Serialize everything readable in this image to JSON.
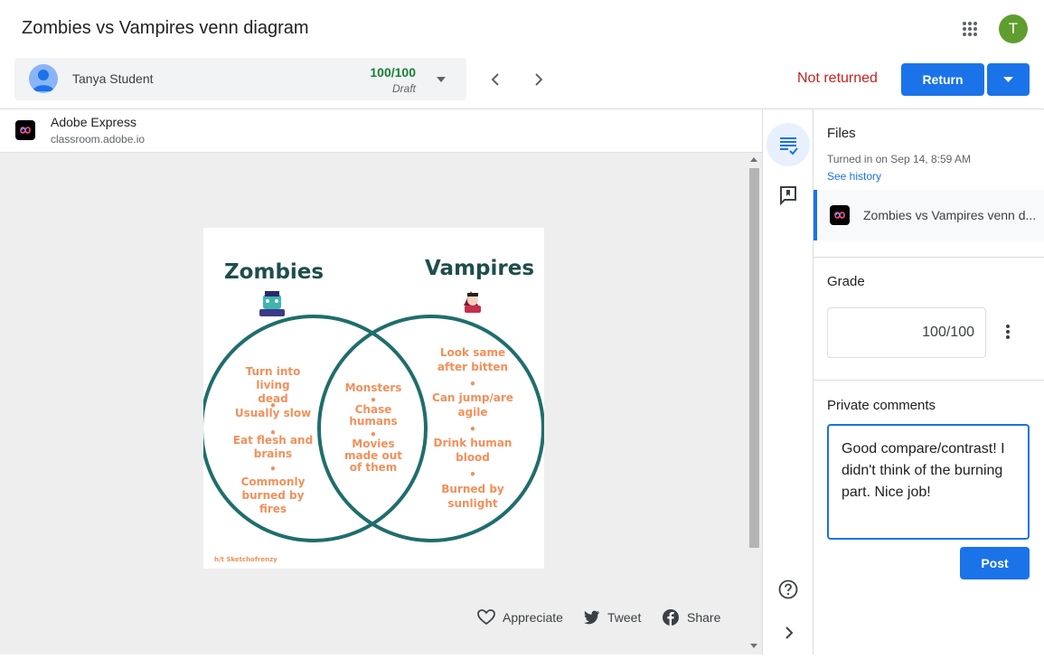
{
  "header": {
    "title": "Zombies vs Vampires venn diagram",
    "apps_icon": "apps-grid-icon",
    "avatar_letter": "T",
    "avatar_color": "#5f9d2f"
  },
  "student": {
    "name": "Tanya Student",
    "grade": "100/100",
    "status": "Draft",
    "grade_color": "#188038"
  },
  "status_text": "Not returned",
  "status_color": "#c5221f",
  "return_button": "Return",
  "accent": "#1a73e8",
  "viewer": {
    "app_name": "Adobe Express",
    "app_url": "classroom.adobe.io",
    "actions": [
      "Appreciate",
      "Tweet",
      "Share"
    ]
  },
  "diagram": {
    "left_title": "Zombies",
    "right_title": "Vampires",
    "left_items": [
      "Turn into living\ndead",
      "Usually slow",
      "Eat flesh and\nbrains",
      "Commonly\nburned by\nfires"
    ],
    "middle_items": [
      "Monsters",
      "Chase\nhumans",
      "Movies\nmade out\nof them"
    ],
    "right_items": [
      "Look same\nafter bitten",
      "Can jump/are\nagile",
      "Drink human\nblood",
      "Burned by\nsunlight"
    ],
    "credit": "h/t Sketchofrenzy",
    "ring_color": "#1f6e6c",
    "text_color": "#f2905a"
  },
  "panel": {
    "files_title": "Files",
    "turned_in": "Turned in on Sep 14, 8:59 AM",
    "see_history": "See history",
    "file_name": "Zombies vs Vampires venn d...",
    "grade_title": "Grade",
    "grade_value": "100/100",
    "comments_title": "Private comments",
    "comment_text": "Good compare/contrast! I didn't think of the burning part. Nice job!",
    "post_button": "Post"
  }
}
